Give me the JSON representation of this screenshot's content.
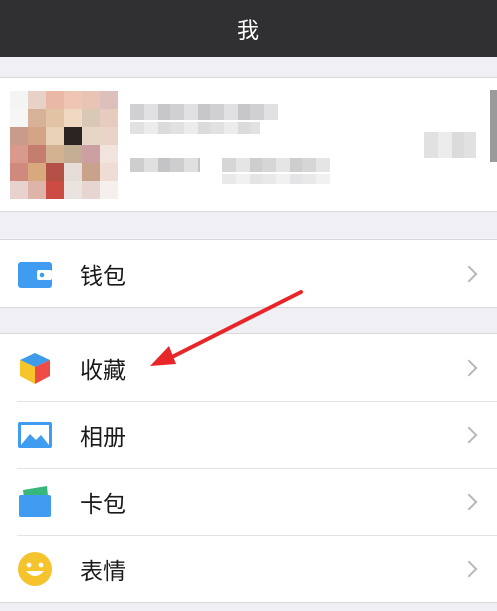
{
  "navbar": {
    "title": "我"
  },
  "menu": {
    "wallet": {
      "label": "钱包",
      "icon": "wallet-icon"
    },
    "favorites": {
      "label": "收藏",
      "icon": "favorites-cube-icon"
    },
    "album": {
      "label": "相册",
      "icon": "album-icon"
    },
    "cards": {
      "label": "卡包",
      "icon": "card-holder-icon"
    },
    "stickers": {
      "label": "表情",
      "icon": "emoji-icon"
    }
  },
  "colors": {
    "navbar_bg": "#303032",
    "page_bg": "#efeff4",
    "annotation_arrow": "#e8262a"
  }
}
